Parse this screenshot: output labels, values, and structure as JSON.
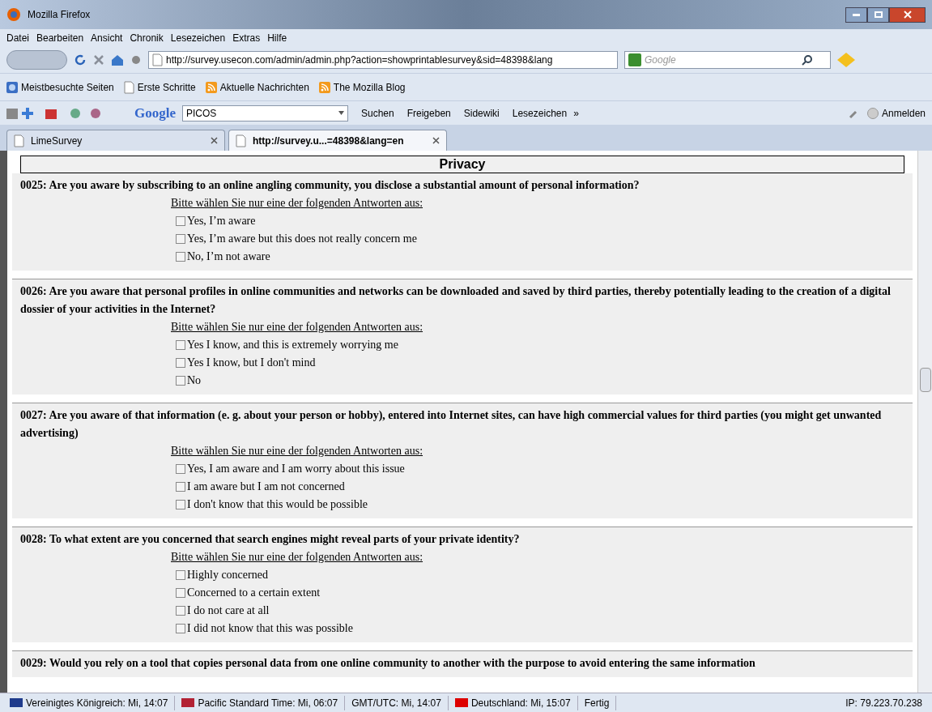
{
  "window": {
    "title": "Mozilla Firefox"
  },
  "menu": [
    "Datei",
    "Bearbeiten",
    "Ansicht",
    "Chronik",
    "Lesezeichen",
    "Extras",
    "Hilfe"
  ],
  "address": {
    "value": "http://survey.usecon.com/admin/admin.php?action=showprintablesurvey&sid=48398&lang"
  },
  "search": {
    "placeholder": "Google"
  },
  "bookmarks": [
    {
      "label": "Meistbesuchte Seiten",
      "kind": "globe"
    },
    {
      "label": "Erste Schritte",
      "kind": "page"
    },
    {
      "label": "Aktuelle Nachrichten",
      "kind": "feed"
    },
    {
      "label": "The Mozilla Blog",
      "kind": "feed"
    }
  ],
  "google_toolbar": {
    "brand": "Google",
    "query": "PICOS",
    "buttons": [
      "Suchen",
      "Freigeben",
      "Sidewiki",
      "Lesezeichen"
    ],
    "more": "»",
    "signin": "Anmelden"
  },
  "tabs": [
    {
      "label": "LimeSurvey",
      "selected": false
    },
    {
      "label": "http://survey.u...=48398&lang=en",
      "selected": true
    }
  ],
  "survey": {
    "section": "Privacy",
    "questions": [
      {
        "text": "0025: Are you aware by subscribing to an online angling community, you disclose a substantial amount of personal information?",
        "instruction": "Bitte wählen Sie nur eine der folgenden Antworten aus:",
        "options": [
          {
            "label": "Yes, I’m aware",
            "checked": false
          },
          {
            "label": "Yes, I’m aware but this does not really concern me",
            "checked": false
          },
          {
            "label": "No, I’m not aware",
            "checked": false
          }
        ]
      },
      {
        "text": "0026: Are you aware that personal profiles in online communities and networks can be downloaded and saved by third parties, thereby potentially leading to the creation of a digital dossier of your activities in the Internet?",
        "instruction": "Bitte wählen Sie nur eine der folgenden Antworten aus:",
        "options": [
          {
            "label": "Yes I know, and this is extremely worrying me",
            "checked": false
          },
          {
            "label": "Yes I know, but I don't mind",
            "checked": false
          },
          {
            "label": "No",
            "checked": false
          }
        ]
      },
      {
        "text": "0027: Are you aware of that information (e. g. about your person or hobby), entered into Internet sites, can have high commercial values for third parties (you might get unwanted advertising)",
        "instruction": "Bitte wählen Sie nur eine der folgenden Antworten aus:",
        "options": [
          {
            "label": "Yes, I am aware and I am worry about this issue",
            "checked": false
          },
          {
            "label": "I am aware but I am not concerned",
            "checked": false
          },
          {
            "label": "I don't know that this would be possible",
            "checked": false
          }
        ]
      },
      {
        "text": "0028: To what extent are you concerned that search engines might reveal parts of your private identity?",
        "instruction": "Bitte wählen Sie nur eine der folgenden Antworten aus:",
        "options": [
          {
            "label": "Highly concerned",
            "checked": false
          },
          {
            "label": "Concerned to a certain extent",
            "checked": false
          },
          {
            "label": "I do not care at all",
            "checked": false
          },
          {
            "label": "I did not know that this was possible",
            "checked": false
          }
        ]
      },
      {
        "text": "0029: Would you rely on a tool that copies personal data from one online community to another with the purpose to avoid entering the same information"
      }
    ]
  },
  "status_bar": [
    {
      "text": "Vereinigtes Königreich: Mi, 14:07",
      "color": "#1f3b8c"
    },
    {
      "text": "Pacific Standard Time: Mi, 06:07",
      "color": "#b22234"
    },
    {
      "text": "GMT/UTC: Mi, 14:07"
    },
    {
      "text": "Deutschland: Mi, 15:07",
      "color": "#dd0000"
    },
    {
      "text": "Fertig"
    },
    {
      "text": "IP: 79.223.70.238"
    }
  ]
}
